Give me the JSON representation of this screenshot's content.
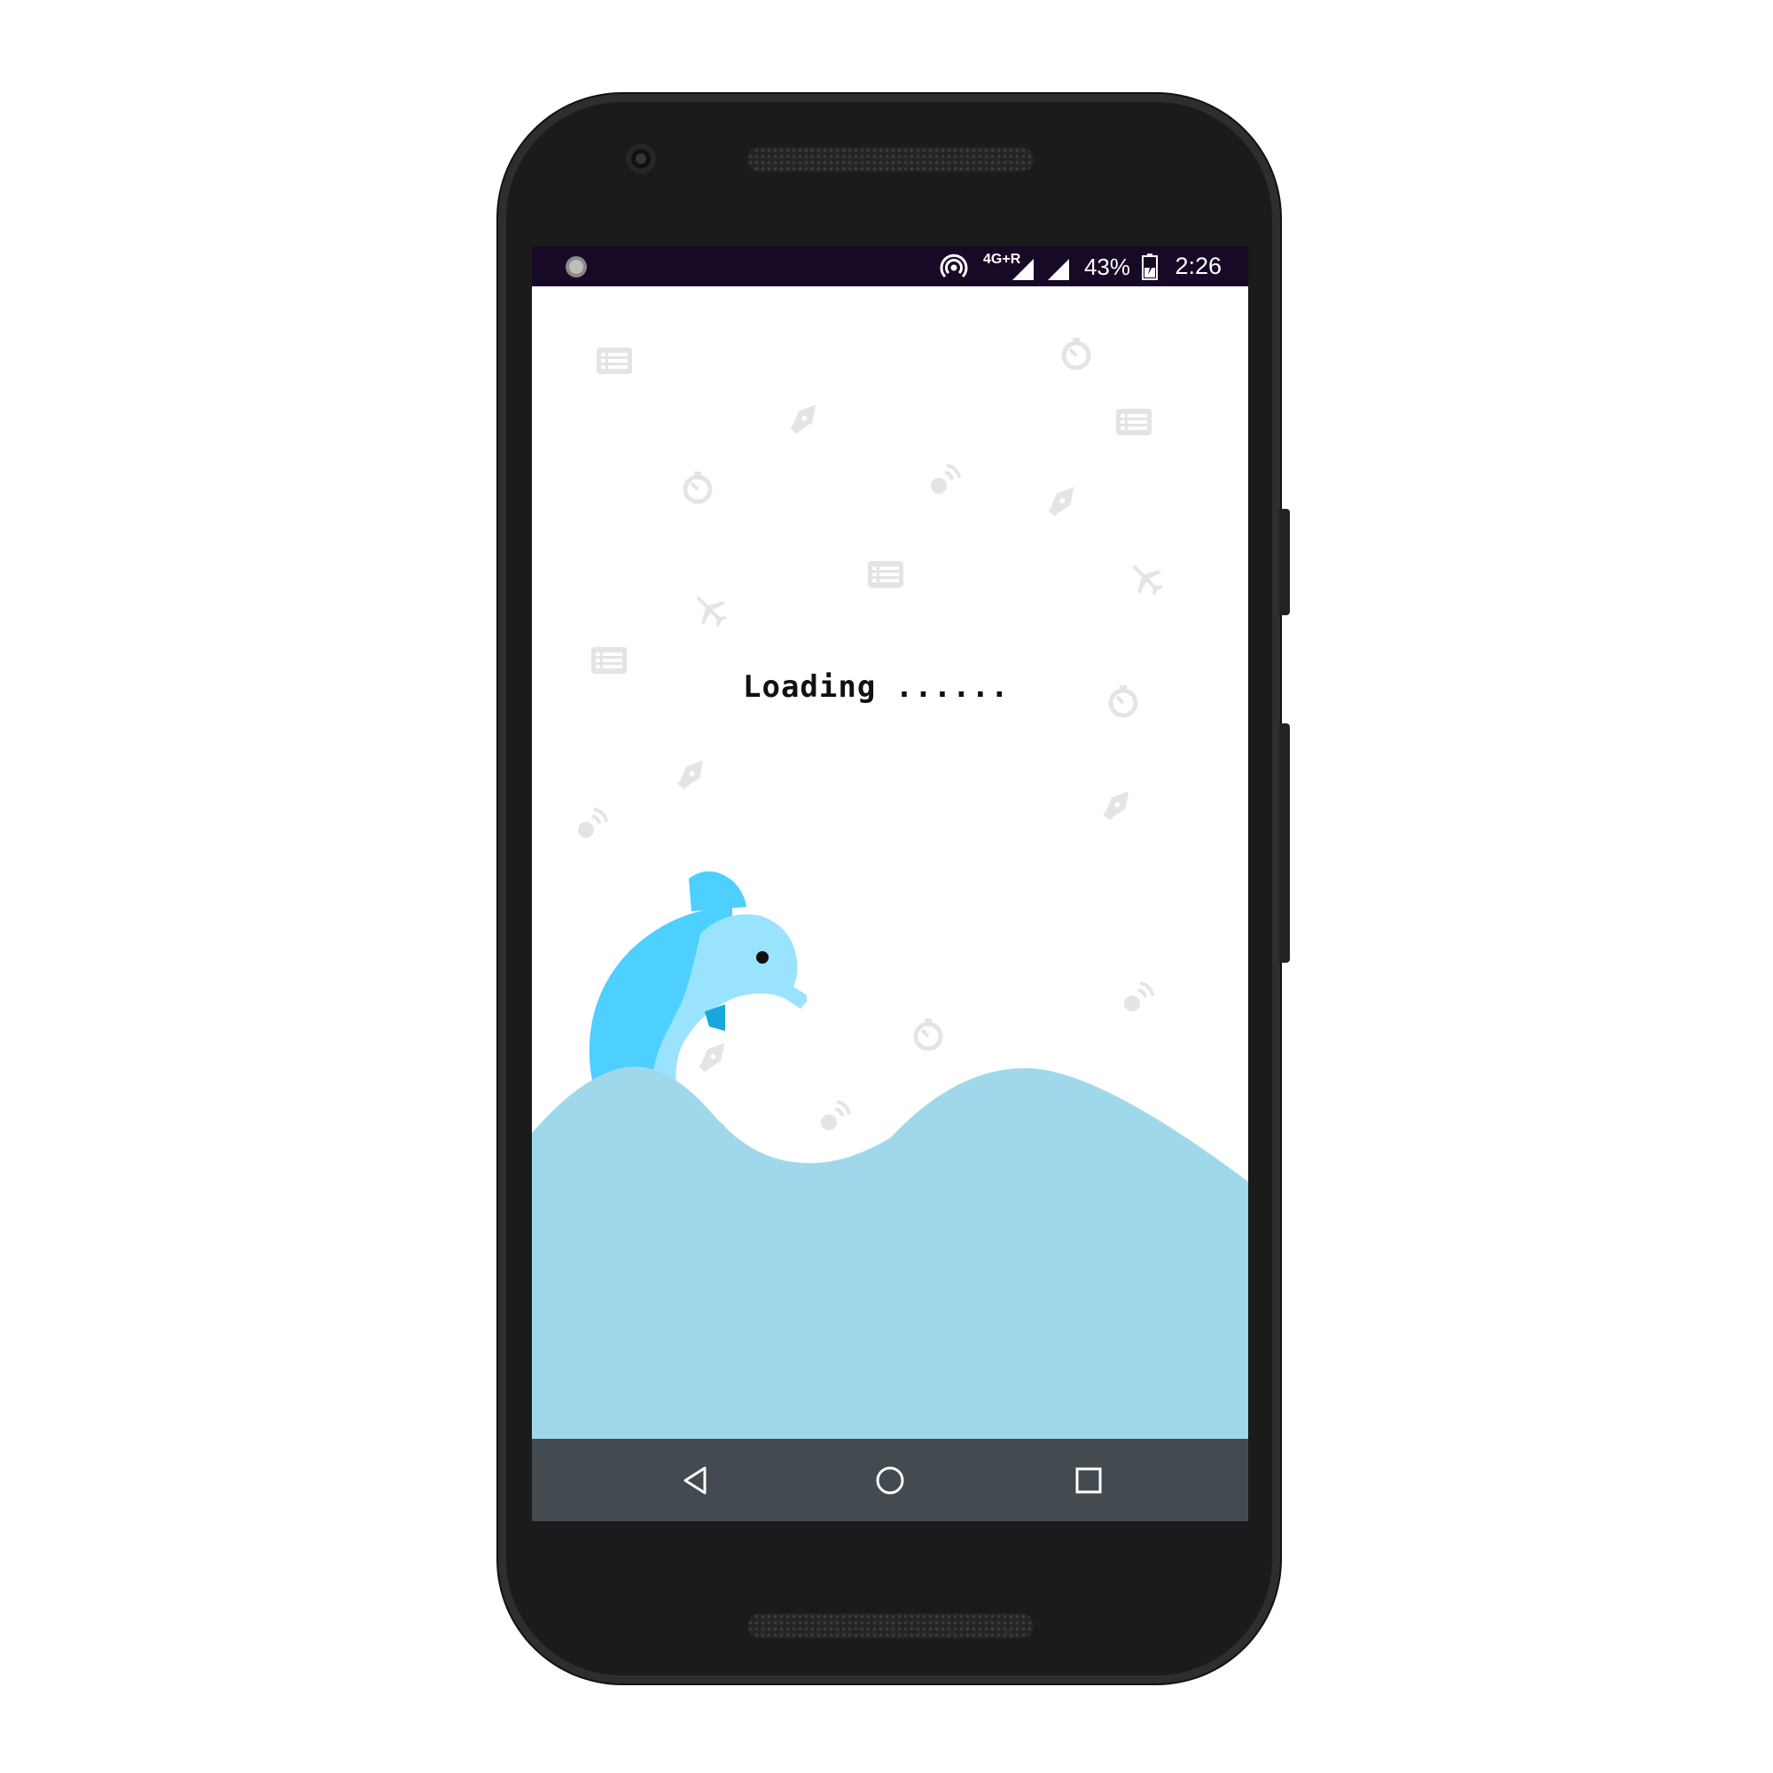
{
  "status_bar": {
    "network": "4G+R",
    "battery_percent": "43%",
    "time": "2:26"
  },
  "loading": {
    "text": "Loading ......"
  },
  "background_icons": [
    "list-icon",
    "pen-icon",
    "timer-icon",
    "satellite-icon",
    "airplane-icon"
  ],
  "colors": {
    "status_bar": "#180a27",
    "wave": "#a0d8eb",
    "dolphin_body": "#4dcfff",
    "dolphin_belly": "#99e3ff",
    "dolphin_fin_dark": "#1aa7dd",
    "nav_bar": "#434b51",
    "bg_icon": "#e3e3e3"
  },
  "navigation": {
    "back_icon": "back-triangle-icon",
    "home_icon": "home-circle-icon",
    "recents_icon": "recents-square-icon"
  }
}
